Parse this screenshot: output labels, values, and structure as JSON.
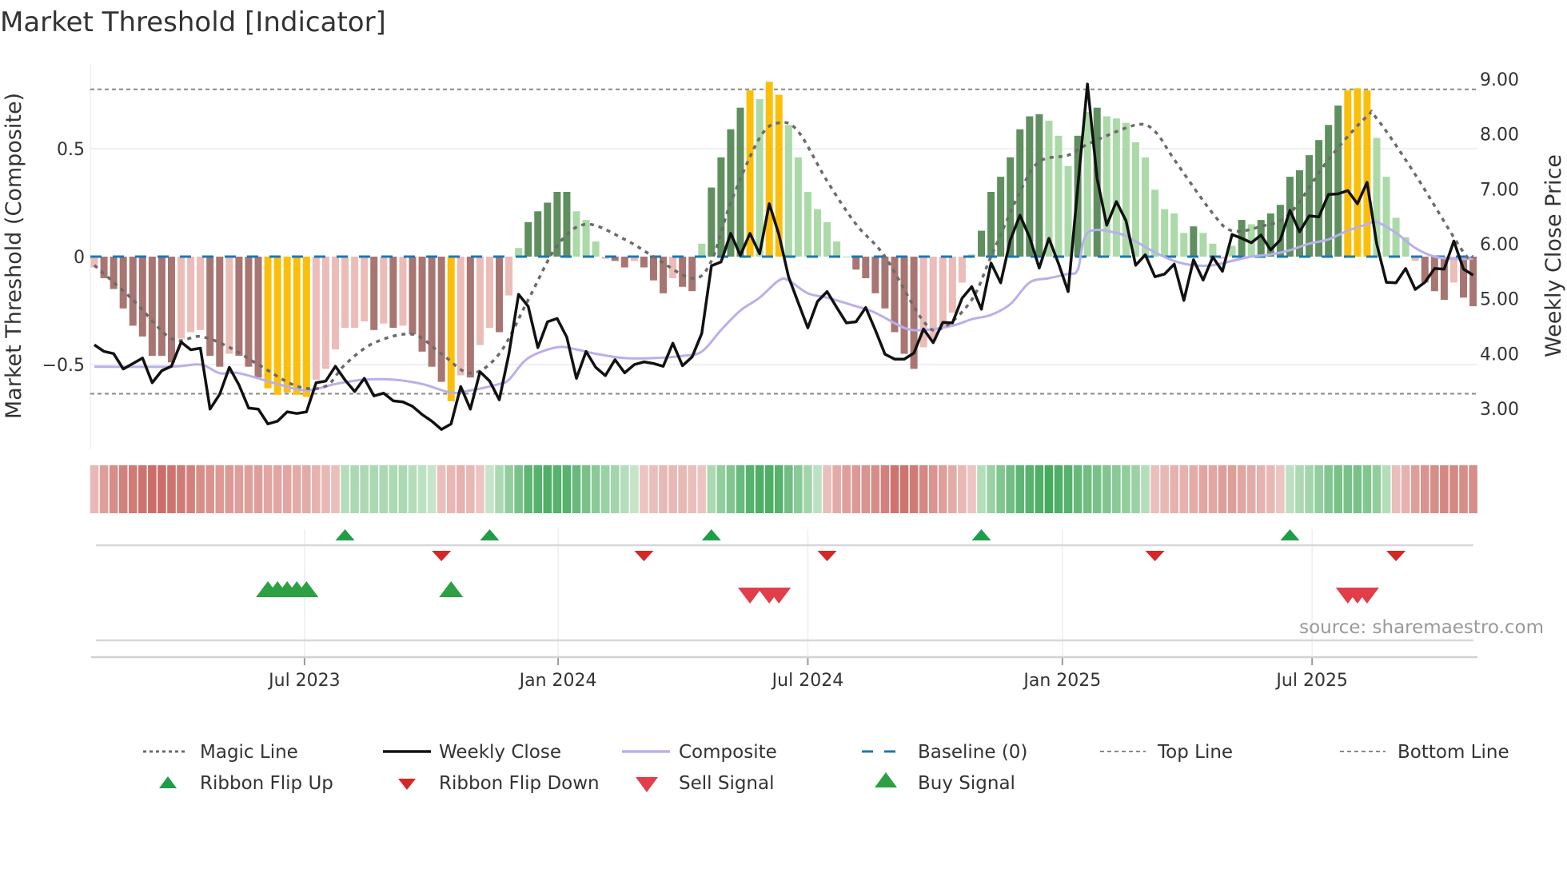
{
  "chart_data": {
    "type": "bar",
    "title": "Market Threshold [Indicator]",
    "ylabel": "Market Threshold (Composite)",
    "ylabel_right": "Weekly Close Price",
    "x_unit": "week index",
    "ylim": [
      -0.95,
      0.82
    ],
    "ylim_right": [
      2.3,
      9.3
    ],
    "yticks": [
      {
        "value": -0.5,
        "label": "−0.5"
      },
      {
        "value": 0,
        "label": "0"
      },
      {
        "value": 0.5,
        "label": "0.5"
      }
    ],
    "yticks_right": [
      {
        "value": 3,
        "label": "3.00"
      },
      {
        "value": 4,
        "label": "4.00"
      },
      {
        "value": 5,
        "label": "5.00"
      },
      {
        "value": 6,
        "label": "6.00"
      },
      {
        "value": 7,
        "label": "7.00"
      },
      {
        "value": 8,
        "label": "8.00"
      },
      {
        "value": 9,
        "label": "9.00"
      }
    ],
    "xticks": [
      {
        "index": 21.8,
        "label": "Jul 2023"
      },
      {
        "index": 48.1,
        "label": "Jan 2024"
      },
      {
        "index": 74.0,
        "label": "Jul 2024"
      },
      {
        "index": 100.4,
        "label": "Jan 2025"
      },
      {
        "index": 126.3,
        "label": "Jul 2025"
      }
    ],
    "top_line": 0.775,
    "bottom_line": -0.635,
    "baseline": 0,
    "colors": {
      "neg_dark": "#a87672",
      "neg_light": "#ebbcb8",
      "pos_dark": "#5f8f5f",
      "pos_light": "#acd9a8",
      "extreme": "#fbbf0b",
      "close": "#111111",
      "composite": "#b8b0ea",
      "magic": "#6b6b6b",
      "baseline": "#1f77b4",
      "threshold": "#888888",
      "flip_up": "#1f9e48",
      "flip_down": "#d62728",
      "sell": "#e23d4b",
      "buy": "#2ca043"
    },
    "histogram": {
      "values": [
        -0.05,
        -0.1,
        -0.15,
        -0.24,
        -0.32,
        -0.37,
        -0.46,
        -0.46,
        -0.49,
        -0.38,
        -0.35,
        -0.34,
        -0.46,
        -0.51,
        -0.45,
        -0.46,
        -0.51,
        -0.56,
        -0.61,
        -0.64,
        -0.63,
        -0.64,
        -0.65,
        -0.57,
        -0.52,
        -0.43,
        -0.33,
        -0.33,
        -0.3,
        -0.34,
        -0.31,
        -0.33,
        -0.32,
        -0.36,
        -0.44,
        -0.51,
        -0.58,
        -0.67,
        -0.55,
        -0.56,
        -0.41,
        -0.33,
        -0.35,
        -0.18,
        0.04,
        0.16,
        0.21,
        0.25,
        0.3,
        0.3,
        0.21,
        0.17,
        0.07,
        -0.01,
        -0.02,
        -0.05,
        -0.02,
        -0.05,
        -0.11,
        -0.17,
        -0.1,
        -0.14,
        -0.16,
        0.06,
        0.32,
        0.46,
        0.59,
        0.69,
        0.77,
        0.73,
        0.81,
        0.75,
        0.61,
        0.46,
        0.3,
        0.22,
        0.16,
        0.07,
        0,
        -0.06,
        -0.1,
        -0.17,
        -0.24,
        -0.35,
        -0.45,
        -0.52,
        -0.42,
        -0.39,
        -0.33,
        -0.26,
        -0.12,
        0.01,
        0.12,
        0.3,
        0.37,
        0.46,
        0.59,
        0.65,
        0.66,
        0.63,
        0.56,
        0.42,
        0.56,
        0.67,
        0.69,
        0.65,
        0.64,
        0.62,
        0.53,
        0.46,
        0.31,
        0.22,
        0.2,
        0.11,
        0.14,
        0.11,
        0.06,
        -0.01,
        0.05,
        0.17,
        0.15,
        0.17,
        0.2,
        0.24,
        0.37,
        0.4,
        0.47,
        0.54,
        0.61,
        0.7,
        0.77,
        0.78,
        0.77,
        0.55,
        0.37,
        0.18,
        0.09,
        -0.02,
        -0.12,
        -0.16,
        -0.2,
        -0.12,
        -0.19,
        -0.23
      ],
      "styles": [
        "L",
        "D",
        "D",
        "D",
        "D",
        "D",
        "D",
        "D",
        "D",
        "L",
        "L",
        "L",
        "D",
        "D",
        "L",
        "D",
        "D",
        "D",
        "Y",
        "Y",
        "Y",
        "Y",
        "Y",
        "L",
        "L",
        "L",
        "L",
        "L",
        "L",
        "D",
        "L",
        "D",
        "L",
        "D",
        "D",
        "D",
        "D",
        "Y",
        "L",
        "D",
        "L",
        "L",
        "D",
        "L",
        "L",
        "D",
        "D",
        "D",
        "D",
        "D",
        "L",
        "L",
        "L",
        "L",
        "D",
        "D",
        "L",
        "D",
        "D",
        "D",
        "L",
        "D",
        "D",
        "L",
        "D",
        "D",
        "D",
        "D",
        "Y",
        "L",
        "Y",
        "Y",
        "L",
        "L",
        "L",
        "L",
        "L",
        "L",
        "L",
        "D",
        "D",
        "D",
        "D",
        "D",
        "D",
        "D",
        "L",
        "L",
        "L",
        "L",
        "L",
        "L",
        "D",
        "D",
        "D",
        "D",
        "D",
        "D",
        "D",
        "L",
        "L",
        "L",
        "D",
        "L",
        "D",
        "L",
        "L",
        "L",
        "L",
        "L",
        "L",
        "L",
        "L",
        "L",
        "D",
        "L",
        "L",
        "L",
        "L",
        "D",
        "L",
        "D",
        "D",
        "D",
        "D",
        "D",
        "D",
        "D",
        "D",
        "D",
        "Y",
        "Y",
        "Y",
        "L",
        "L",
        "L",
        "L",
        "L",
        "D",
        "D",
        "D",
        "L",
        "D",
        "D"
      ]
    },
    "weekly_close": [
      4.16,
      4.04,
      4.0,
      3.72,
      3.82,
      3.92,
      3.47,
      3.69,
      3.77,
      4.21,
      4.07,
      4.1,
      2.99,
      3.26,
      3.75,
      3.43,
      3.01,
      2.99,
      2.72,
      2.77,
      2.94,
      2.91,
      2.94,
      3.47,
      3.5,
      3.77,
      3.52,
      3.31,
      3.55,
      3.23,
      3.28,
      3.14,
      3.12,
      3.04,
      2.89,
      2.77,
      2.62,
      2.72,
      3.4,
      2.99,
      3.67,
      3.5,
      3.16,
      4.0,
      5.08,
      4.86,
      4.11,
      4.58,
      4.64,
      4.3,
      3.55,
      4.04,
      3.75,
      3.6,
      3.89,
      3.65,
      3.8,
      3.85,
      3.82,
      3.77,
      4.19,
      3.78,
      3.94,
      4.37,
      5.6,
      5.67,
      6.19,
      5.79,
      6.19,
      5.82,
      6.73,
      6.17,
      5.4,
      4.93,
      4.47,
      4.95,
      5.13,
      4.84,
      4.56,
      4.58,
      4.84,
      4.43,
      3.99,
      3.9,
      3.9,
      4.01,
      4.45,
      4.2,
      4.57,
      4.56,
      5.01,
      5.22,
      4.81,
      5.65,
      5.29,
      6.07,
      6.52,
      6.12,
      5.56,
      6.1,
      5.64,
      5.13,
      7.04,
      8.91,
      7.19,
      6.34,
      6.77,
      6.42,
      5.61,
      5.8,
      5.4,
      5.45,
      5.63,
      4.97,
      5.71,
      5.34,
      5.76,
      5.5,
      6.17,
      6.1,
      6.02,
      6.16,
      5.89,
      6.07,
      6.61,
      6.22,
      6.51,
      6.49,
      6.9,
      6.91,
      6.97,
      6.73,
      7.12,
      6.0,
      5.3,
      5.29,
      5.55,
      5.17,
      5.3,
      5.55,
      5.54,
      6.05,
      5.54,
      5.43
    ],
    "magic_line": [
      [
        0,
        -0.04
      ],
      [
        4,
        -0.2
      ],
      [
        8,
        -0.38
      ],
      [
        11,
        -0.37
      ],
      [
        14,
        -0.42
      ],
      [
        17,
        -0.5
      ],
      [
        21,
        -0.6
      ],
      [
        24,
        -0.6
      ],
      [
        26,
        -0.5
      ],
      [
        29,
        -0.4
      ],
      [
        33,
        -0.36
      ],
      [
        36,
        -0.45
      ],
      [
        39,
        -0.54
      ],
      [
        42,
        -0.45
      ],
      [
        45,
        -0.2
      ],
      [
        48,
        0.05
      ],
      [
        51,
        0.15
      ],
      [
        55,
        0.08
      ],
      [
        58,
        0.0
      ],
      [
        62,
        -0.1
      ],
      [
        64,
        -0.02
      ],
      [
        66,
        0.25
      ],
      [
        69,
        0.55
      ],
      [
        71,
        0.62
      ],
      [
        73,
        0.58
      ],
      [
        76,
        0.35
      ],
      [
        79,
        0.15
      ],
      [
        82,
        0.0
      ],
      [
        86,
        -0.3
      ],
      [
        88,
        -0.33
      ],
      [
        91,
        -0.2
      ],
      [
        93,
        0.0
      ],
      [
        96,
        0.3
      ],
      [
        98,
        0.44
      ],
      [
        101,
        0.47
      ],
      [
        103,
        0.52
      ],
      [
        108,
        0.61
      ],
      [
        110,
        0.58
      ],
      [
        112,
        0.45
      ],
      [
        116,
        0.2
      ],
      [
        118,
        0.12
      ],
      [
        121,
        0.14
      ],
      [
        124,
        0.2
      ],
      [
        128,
        0.45
      ],
      [
        132,
        0.65
      ],
      [
        133,
        0.64
      ],
      [
        137,
        0.38
      ],
      [
        142,
        0.02
      ],
      [
        143,
        0.0
      ]
    ],
    "composite": [
      [
        0,
        -0.51
      ],
      [
        8,
        -0.51
      ],
      [
        11,
        -0.5
      ],
      [
        13,
        -0.54
      ],
      [
        15,
        -0.54
      ],
      [
        19,
        -0.59
      ],
      [
        22,
        -0.62
      ],
      [
        25,
        -0.59
      ],
      [
        28,
        -0.57
      ],
      [
        31,
        -0.57
      ],
      [
        34,
        -0.59
      ],
      [
        37,
        -0.63
      ],
      [
        39,
        -0.62
      ],
      [
        42,
        -0.59
      ],
      [
        43,
        -0.57
      ],
      [
        45,
        -0.47
      ],
      [
        48,
        -0.42
      ],
      [
        50,
        -0.43
      ],
      [
        52,
        -0.45
      ],
      [
        55,
        -0.47
      ],
      [
        58,
        -0.47
      ],
      [
        61,
        -0.46
      ],
      [
        63,
        -0.44
      ],
      [
        65,
        -0.34
      ],
      [
        67,
        -0.25
      ],
      [
        69,
        -0.19
      ],
      [
        71,
        -0.11
      ],
      [
        72,
        -0.11
      ],
      [
        74,
        -0.17
      ],
      [
        76,
        -0.19
      ],
      [
        79,
        -0.23
      ],
      [
        81,
        -0.26
      ],
      [
        84,
        -0.33
      ],
      [
        86,
        -0.34
      ],
      [
        89,
        -0.32
      ],
      [
        91,
        -0.29
      ],
      [
        93,
        -0.27
      ],
      [
        95,
        -0.22
      ],
      [
        97,
        -0.12
      ],
      [
        99,
        -0.1
      ],
      [
        101,
        -0.08
      ],
      [
        102,
        -0.06
      ],
      [
        103,
        0.11
      ],
      [
        106,
        0.11
      ],
      [
        108,
        0.07
      ],
      [
        110,
        0.02
      ],
      [
        112,
        -0.02
      ],
      [
        114,
        -0.04
      ],
      [
        116,
        -0.04
      ],
      [
        118,
        -0.02
      ],
      [
        120,
        0.0
      ],
      [
        122,
        0.01
      ],
      [
        124,
        0.03
      ],
      [
        126,
        0.06
      ],
      [
        128,
        0.08
      ],
      [
        130,
        0.12
      ],
      [
        132,
        0.15
      ],
      [
        133,
        0.16
      ],
      [
        135,
        0.11
      ],
      [
        137,
        0.04
      ],
      [
        139,
        0.0
      ],
      [
        141,
        -0.01
      ],
      [
        143,
        -0.01
      ]
    ],
    "ribbon": [
      -0.25,
      -0.45,
      -0.6,
      -0.7,
      -0.75,
      -0.8,
      -0.85,
      -0.85,
      -0.8,
      -0.75,
      -0.7,
      -0.6,
      -0.55,
      -0.5,
      -0.5,
      -0.45,
      -0.45,
      -0.45,
      -0.4,
      -0.4,
      -0.4,
      -0.35,
      -0.35,
      -0.3,
      -0.25,
      -0.2,
      0.25,
      0.3,
      0.3,
      0.3,
      0.3,
      0.3,
      0.3,
      0.25,
      0.2,
      0.15,
      -0.2,
      -0.25,
      -0.3,
      -0.25,
      -0.15,
      0.15,
      0.3,
      0.45,
      0.6,
      0.75,
      0.8,
      0.85,
      0.8,
      0.8,
      0.7,
      0.6,
      0.5,
      0.4,
      0.35,
      0.25,
      0.15,
      -0.15,
      -0.2,
      -0.25,
      -0.25,
      -0.25,
      -0.2,
      -0.15,
      0.3,
      0.45,
      0.55,
      0.7,
      0.8,
      0.85,
      0.85,
      0.8,
      0.65,
      0.5,
      0.35,
      0.2,
      -0.2,
      -0.35,
      -0.45,
      -0.5,
      -0.55,
      -0.6,
      -0.7,
      -0.8,
      -0.8,
      -0.75,
      -0.65,
      -0.55,
      -0.45,
      -0.35,
      -0.25,
      -0.15,
      0.25,
      0.4,
      0.55,
      0.65,
      0.75,
      0.8,
      0.85,
      0.9,
      0.85,
      0.8,
      0.7,
      0.65,
      0.6,
      0.55,
      0.5,
      0.45,
      0.4,
      0.25,
      -0.2,
      -0.25,
      -0.3,
      -0.3,
      -0.35,
      -0.4,
      -0.4,
      -0.45,
      -0.45,
      -0.4,
      -0.35,
      -0.3,
      -0.25,
      -0.15,
      0.2,
      0.3,
      0.35,
      0.45,
      0.55,
      0.6,
      0.6,
      0.6,
      0.55,
      0.45,
      0.25,
      -0.2,
      -0.3,
      -0.45,
      -0.55,
      -0.6,
      -0.65,
      -0.65,
      -0.6,
      -0.6
    ],
    "signals": {
      "ribbon_flip_up": [
        26,
        41,
        64,
        92,
        124
      ],
      "ribbon_flip_down": [
        36,
        57,
        76,
        110,
        135
      ],
      "buy": [
        18,
        19,
        20,
        21,
        22,
        37
      ],
      "sell": [
        68,
        70,
        71,
        130,
        131,
        132
      ]
    },
    "legend": {
      "placement": "bottom",
      "items": [
        "Magic Line",
        "Weekly Close",
        "Composite",
        "Baseline (0)",
        "Top Line",
        "Bottom Line",
        "Ribbon Flip Up",
        "Ribbon Flip Down",
        "Sell Signal",
        "Buy Signal"
      ]
    },
    "source": "source: sharemaestro.com"
  }
}
